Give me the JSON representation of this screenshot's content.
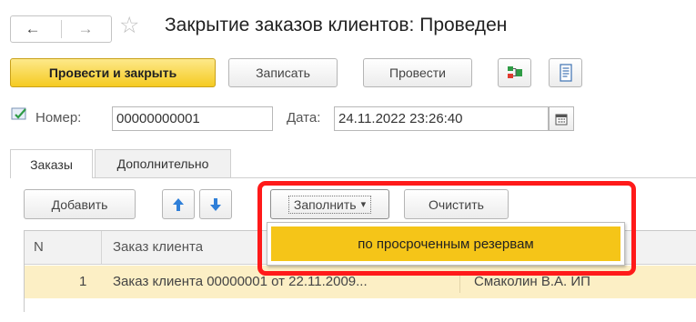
{
  "window": {
    "title": "Закрытие заказов клиентов: Проведен",
    "back_glyph": "←",
    "forward_glyph": "→",
    "star_glyph": "☆"
  },
  "toolbar": {
    "post_and_close": "Провести и закрыть",
    "save": "Записать",
    "post": "Провести",
    "icons": [
      "structure-icon",
      "report-icon"
    ]
  },
  "header": {
    "number_label": "Номер:",
    "number_value": "00000000001",
    "date_label": "Дата:",
    "date_value": "24.11.2022 23:26:40"
  },
  "tabs": [
    {
      "label": "Заказы",
      "active": true
    },
    {
      "label": "Дополнительно",
      "active": false
    }
  ],
  "table_toolbar": {
    "add": "Добавить",
    "fill": "Заполнить",
    "fill_caret": "▾",
    "clear": "Очистить",
    "up_glyph": "🡅",
    "down_glyph": "🡇"
  },
  "fill_menu": {
    "items": [
      "по просроченным резервам"
    ]
  },
  "table": {
    "columns": [
      "N",
      "Заказ клиента"
    ],
    "rows": [
      {
        "n": "1",
        "order": "Заказ клиента 00000001 от 22.11.2009...",
        "manager": "Смаколин В.А. ИП"
      }
    ]
  },
  "colors": {
    "accent": "#f5cb22",
    "highlight_frame": "#ff1a1a",
    "selected_row": "#fcefc5",
    "arrow_blue": "#2f7fd8"
  }
}
